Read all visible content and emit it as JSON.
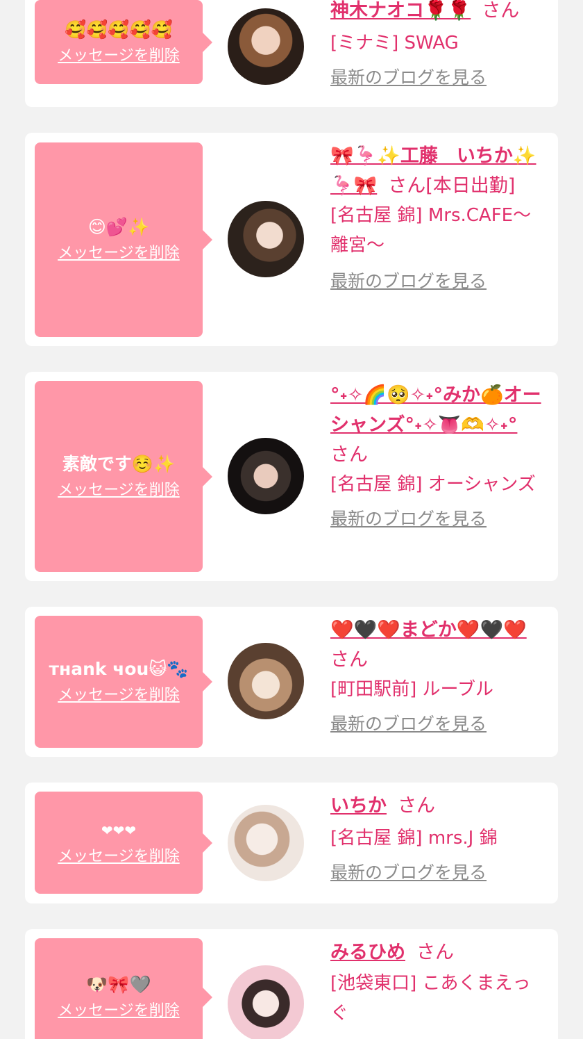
{
  "delete_label": "メッセージを削除",
  "blog_label": "最新のブログを見る",
  "colors": {
    "accent": "#e1306c",
    "bubble": "#ff97a8",
    "card": "#ffffff",
    "background": "#f2f2f2",
    "link_gray": "#8a8a8a"
  },
  "entries": [
    {
      "message": "🥰🥰🥰🥰🥰",
      "name": "神木ナオコ🌹🌹",
      "honorific": "さん",
      "shop": "[ミナミ] SWAG"
    },
    {
      "message": "😊💕✨",
      "name": "🎀🦩✨工藤　いちか✨🦩🎀",
      "honorific": "さん",
      "shop": "[本日出勤]",
      "shop2": "[名古屋 錦] Mrs.CAFE〜離宮〜"
    },
    {
      "message": "素敵です☺️✨",
      "name": "°˖✧🌈🥺✧˖°みか🍊オーシャンズ°˖✧👅🫶✧˖°",
      "honorific": "さん",
      "shop": "[名古屋 錦] オーシャンズ"
    },
    {
      "message": "тнank чou😺🐾",
      "name": "❤️🖤❤️まどか❤️🖤❤️",
      "honorific": "さん",
      "shop": "[町田駅前] ルーブル"
    },
    {
      "message": "❤❤❤",
      "name": "いちか",
      "honorific": "さん",
      "shop": "[名古屋 錦] mrs.J 錦"
    },
    {
      "message": "🐶🎀🩶",
      "name": "みるひめ",
      "honorific": "さん",
      "shop": "[池袋東口] こあくまえっぐ"
    }
  ]
}
